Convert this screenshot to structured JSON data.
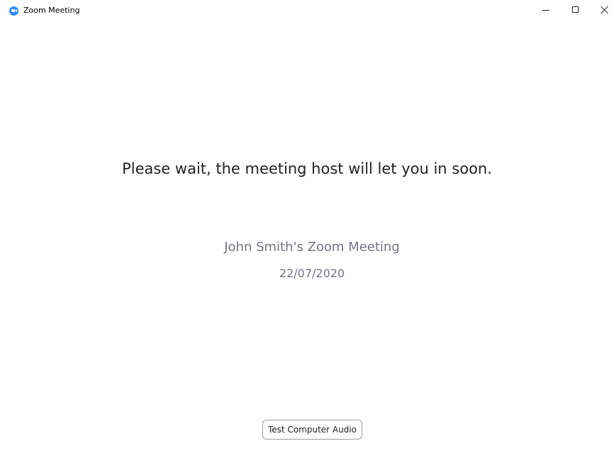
{
  "window": {
    "title": "Zoom Meeting",
    "app_icon": "zoom-logo-icon",
    "controls": [
      "minimize-icon",
      "maximize-icon",
      "close-icon"
    ]
  },
  "main": {
    "wait_message": "Please wait, the meeting host will let you in soon.",
    "meeting_topic": "John Smith's Zoom Meeting",
    "meeting_date": "22/07/2020",
    "test_audio_label": "Test Computer Audio"
  },
  "colors": {
    "accent": "#2D8CFF",
    "secondary_text": "#747487",
    "primary_text": "#222222"
  }
}
